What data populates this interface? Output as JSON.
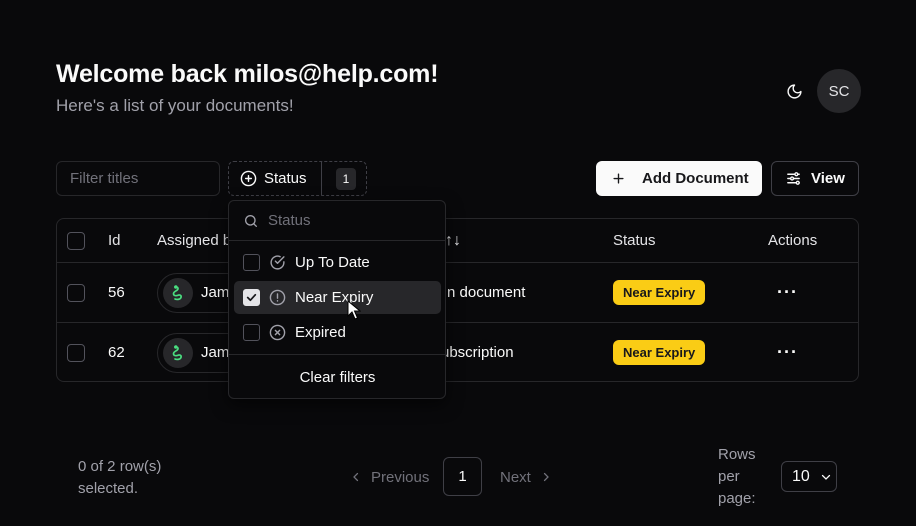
{
  "header": {
    "title": "Welcome back milos@help.com!",
    "subtitle": "Here's a list of your documents!",
    "avatar_initials": "SC",
    "theme_icon": "moon-icon"
  },
  "toolbar": {
    "filter_placeholder": "Filter titles",
    "status_label": "Status",
    "status_count": "1",
    "add_label": "Add Document",
    "view_label": "View"
  },
  "table": {
    "columns": {
      "id": "Id",
      "assigned": "Assigned b",
      "title_sort_icon": "↑↓",
      "status": "Status",
      "actions": "Actions"
    },
    "rows": [
      {
        "id": "56",
        "assignee": "Jame",
        "title": "n document",
        "status": "Near Expiry",
        "actions": "···"
      },
      {
        "id": "62",
        "assignee": "Jame",
        "title": "ubscription",
        "status": "Near Expiry",
        "actions": "···"
      }
    ]
  },
  "status_filter": {
    "search_placeholder": "Status",
    "options": [
      {
        "label": "Up To Date",
        "checked": false,
        "icon": "circle-check-icon"
      },
      {
        "label": "Near Expiry",
        "checked": true,
        "icon": "circle-alert-icon"
      },
      {
        "label": "Expired",
        "checked": false,
        "icon": "circle-x-icon"
      }
    ],
    "clear_label": "Clear filters"
  },
  "pagination": {
    "selected_text": "0 of 2 row(s) selected.",
    "prev_label": "Previous",
    "current_page": "1",
    "next_label": "Next",
    "rows_per_page_label": "Rows per page:",
    "rows_per_page_value": "10"
  },
  "colors": {
    "background": "#09090b",
    "border": "#27272a",
    "badge": "#facc15",
    "muted_text": "#a1a1aa"
  }
}
